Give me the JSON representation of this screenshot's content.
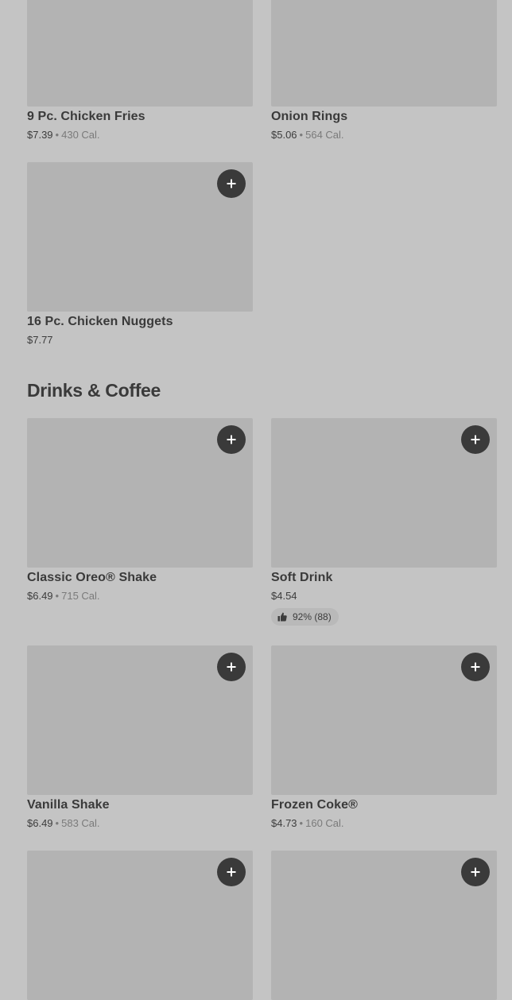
{
  "menu": {
    "top_items": [
      {
        "name": "9 Pc. Chicken Fries",
        "price": "$7.39",
        "calories": "430 Cal."
      },
      {
        "name": "Onion Rings",
        "price": "$5.06",
        "calories": "564 Cal."
      },
      {
        "name": "16 Pc. Chicken Nuggets",
        "price": "$7.77"
      }
    ],
    "drinks_section": {
      "title": "Drinks & Coffee",
      "items": [
        {
          "name": "Classic Oreo® Shake",
          "price": "$6.49",
          "calories": "715 Cal."
        },
        {
          "name": "Soft Drink",
          "price": "$4.54",
          "rating": "92% (88)"
        },
        {
          "name": "Vanilla Shake",
          "price": "$6.49",
          "calories": "583 Cal."
        },
        {
          "name": "Frozen Coke®",
          "price": "$4.73",
          "calories": "160 Cal."
        }
      ]
    },
    "separator": "•"
  },
  "icons": {
    "add": "plus-icon",
    "rating": "thumbs-up-icon"
  },
  "colors": {
    "background": "#c4c4c4",
    "image_placeholder": "#b3b3b3",
    "add_button": "#3a3a3a",
    "text_primary": "#3a3a3a",
    "text_secondary": "#7a7a7a"
  }
}
